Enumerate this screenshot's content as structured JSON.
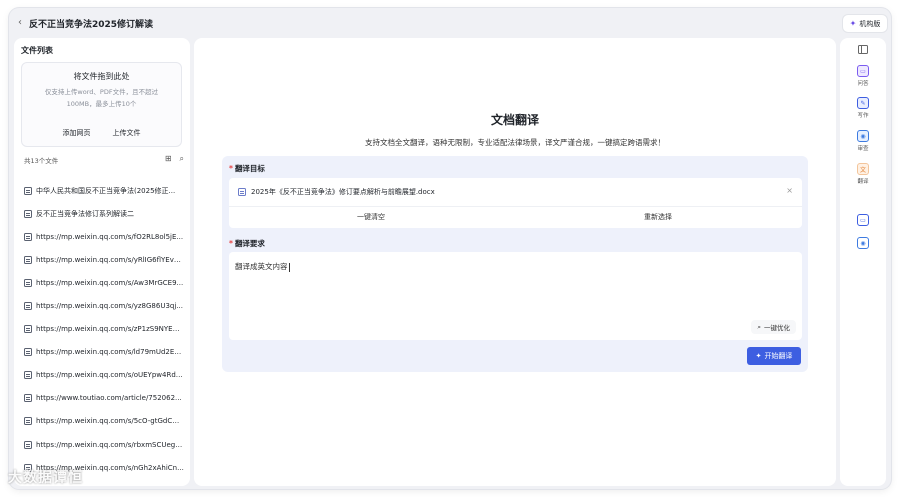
{
  "header": {
    "back_icon": "chevron-left-icon",
    "title": "反不正当竞争法2025修订解读",
    "org_button": "机构版"
  },
  "sidebar": {
    "heading": "文件列表",
    "dropzone": {
      "title": "将文件拖到此处",
      "hint": "仅支持上传word、PDF文件，且不超过100MB，最多上传10个",
      "add_web_label": "添加网页",
      "upload_label": "上传文件"
    },
    "count_label": "共13个文件",
    "files": [
      "中华人民共和国反不正当竞争法(2025修正...",
      "反不正当竞争法修订系列解读二",
      "https://mp.weixin.qq.com/s/fO2RL8ol5jE...",
      "https://mp.weixin.qq.com/s/yRlIG6flYEvp...",
      "https://mp.weixin.qq.com/s/Aw3MrGCE9...",
      "https://mp.weixin.qq.com/s/yz8G86U3qj...",
      "https://mp.weixin.qq.com/s/zP1zS9NYEw...",
      "https://mp.weixin.qq.com/s/ld79mUd2EK...",
      "https://mp.weixin.qq.com/s/oUEYpw4Rdz...",
      "https://www.toutiao.com/article/752062...",
      "https://mp.weixin.qq.com/s/5cO-gtGdCQ...",
      "https://mp.weixin.qq.com/s/rbxmSCUeg4...",
      "https://mp.weixin.qq.com/s/nGh2xAhiCn..."
    ]
  },
  "main": {
    "title": "文档翻译",
    "subtitle": "支持文档全文翻译，语种无限制，专业适配法律场景，译文严谨合规，一键搞定跨语需求！",
    "target_label": "翻译目标",
    "selected_file": "2025年《反不正当竞争法》修订要点解析与前瞻展望.docx",
    "clear_label": "一键清空",
    "reselect_label": "重新选择",
    "requirement_label": "翻译要求",
    "requirement_value": "翻译成英文内容",
    "optimize_label": "一键优化",
    "start_label": "开始翻译"
  },
  "rail": {
    "items": [
      {
        "label": "问答",
        "color": "#7b5cf0",
        "bg": "#efeaff",
        "icon": "chat-icon"
      },
      {
        "label": "写作",
        "color": "#3d5ee1",
        "bg": "#e9eeff",
        "icon": "write-icon"
      },
      {
        "label": "审查",
        "color": "#3d7be1",
        "bg": "#e7f0ff",
        "icon": "review-icon"
      },
      {
        "label": "翻译",
        "color": "#e07b2a",
        "bg": "#fff1e4",
        "icon": "translate-icon"
      }
    ]
  },
  "colors": {
    "accent": "#3d5ee1",
    "required": "#e64545",
    "panel_bg": "#eef1fb"
  },
  "watermark": "大数据谭恒"
}
